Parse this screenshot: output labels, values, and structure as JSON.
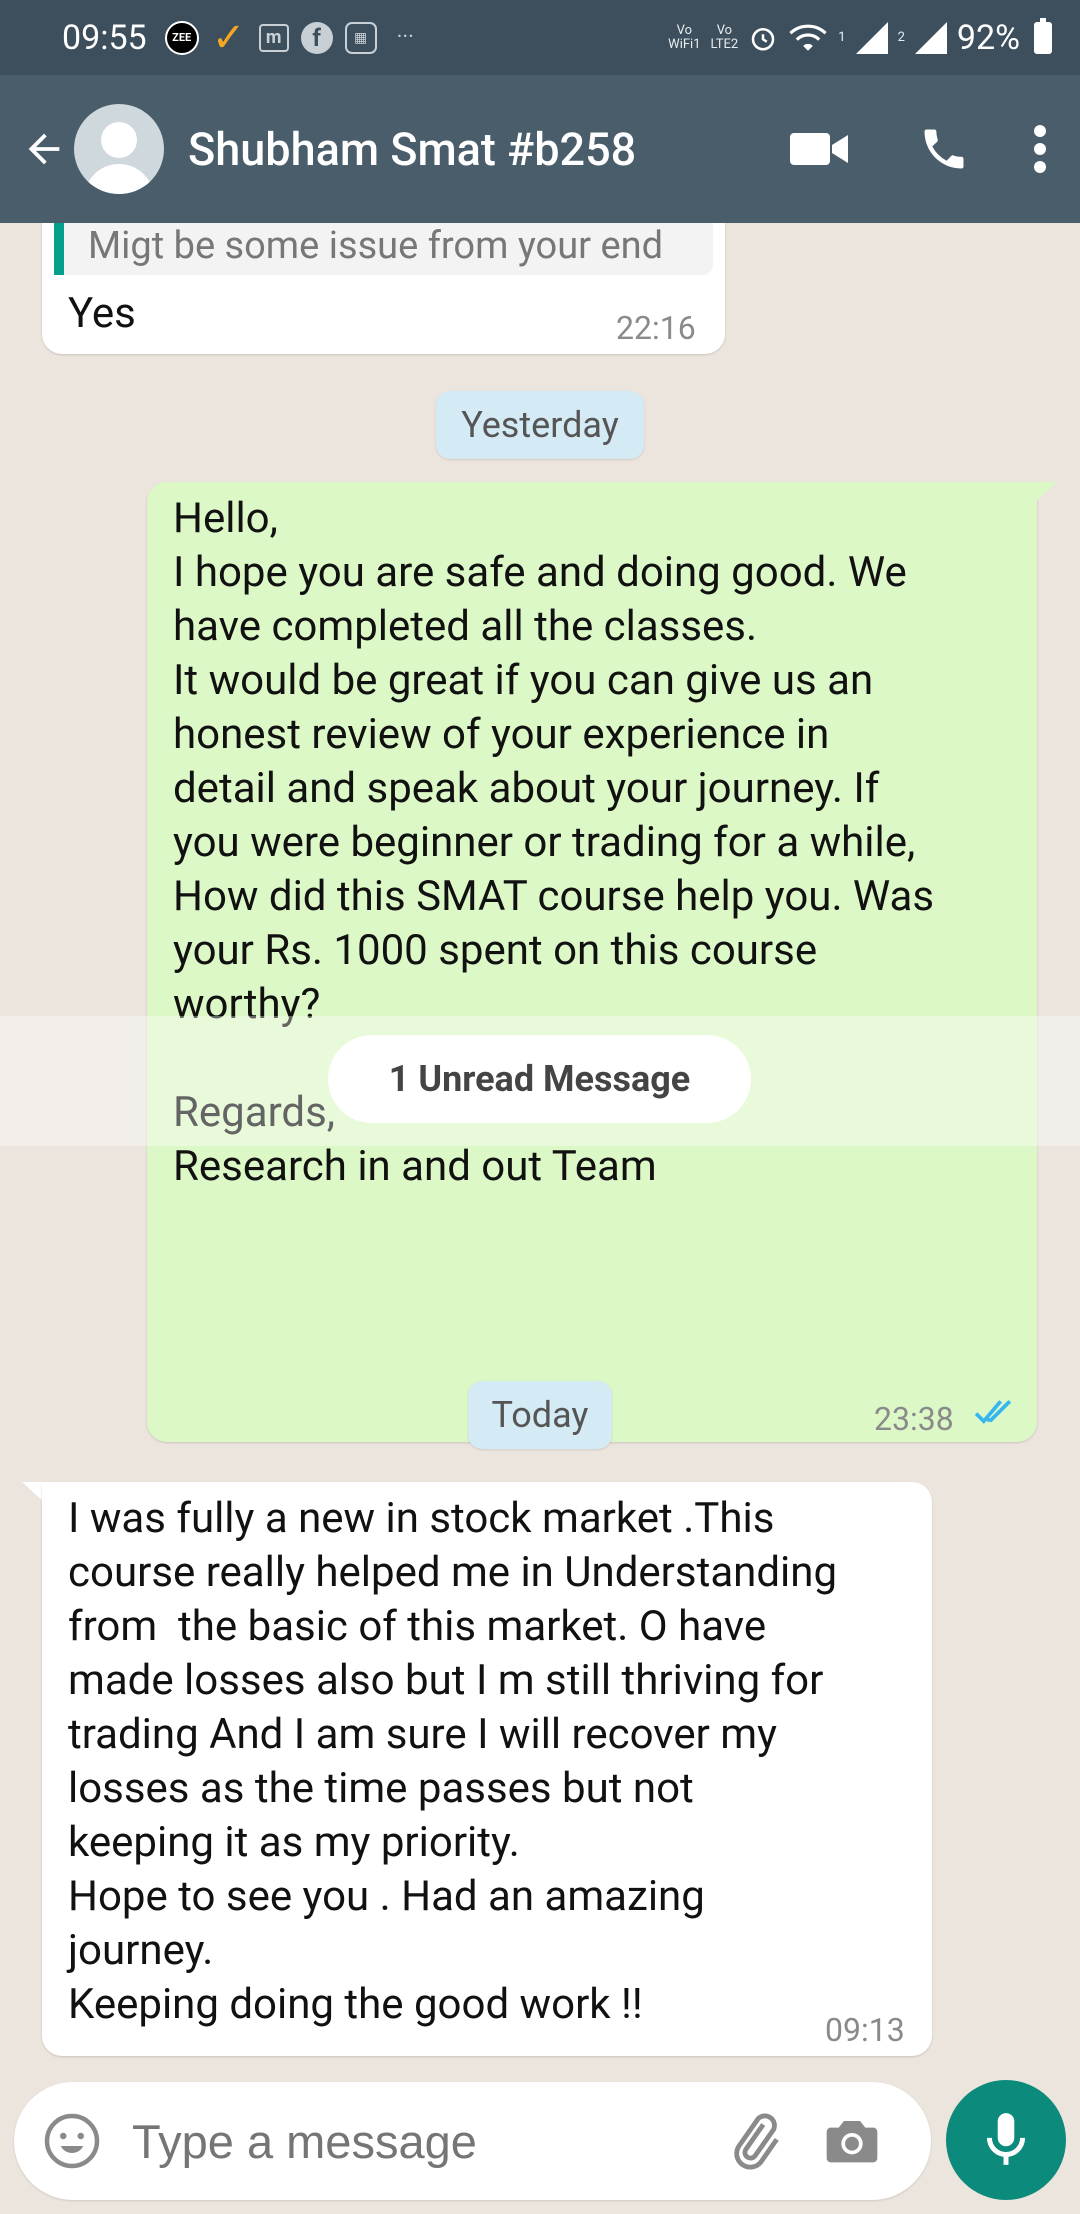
{
  "status_bar": {
    "time": "09:55",
    "volte_wifi_top": "Vo",
    "volte_wifi_bottom": "WiFi1",
    "volte_lte_top": "Vo",
    "volte_lte_bottom": "LTE2",
    "sim1": "1",
    "sim2": "2",
    "battery": "92%",
    "more": "···"
  },
  "header": {
    "contact_name": "Shubham Smat #b258",
    "icons": [
      "back-arrow-icon",
      "avatar",
      "video-call-icon",
      "phone-icon",
      "more-options-icon"
    ]
  },
  "messages": {
    "quoted_reply": "Migt be some issue from your end",
    "m1_text": "Yes",
    "m1_time": "22:16",
    "chip_yesterday": "Yesterday",
    "m2_text": "Hello,\nI hope you are safe and doing good. We\nhave completed all the classes.\nIt would be great if you can give us an\nhonest review of your experience in\ndetail and speak about your journey. If\nyou were beginner or trading for a while,\nHow did this SMAT course help you. Was\nyour Rs. 1000 spent on this course\nworthy?\n\nRegards,\nResearch in and out Team",
    "m2_time": "23:38",
    "unread": "1 Unread Message",
    "chip_today": "Today",
    "m3_text": "I was fully a new in stock market .This\ncourse really helped me in Understanding\nfrom  the basic of this market. O have\nmade losses also but I m still thriving for\ntrading And I am sure I will recover my\nlosses as the time passes but not\nkeeping it as my priority.\nHope to see you . Had an amazing\njourney.\nKeeping doing the good work !!",
    "m3_time": "09:13"
  },
  "composer": {
    "placeholder": "Type a message"
  },
  "colors": {
    "header": "#4a5d6b",
    "status_bar": "#3d4f5c",
    "outgoing_bubble": "#dcf8c6",
    "incoming_bubble": "#ffffff",
    "read_ticks": "#34b7f1",
    "mic_button": "#0c8a7b"
  }
}
